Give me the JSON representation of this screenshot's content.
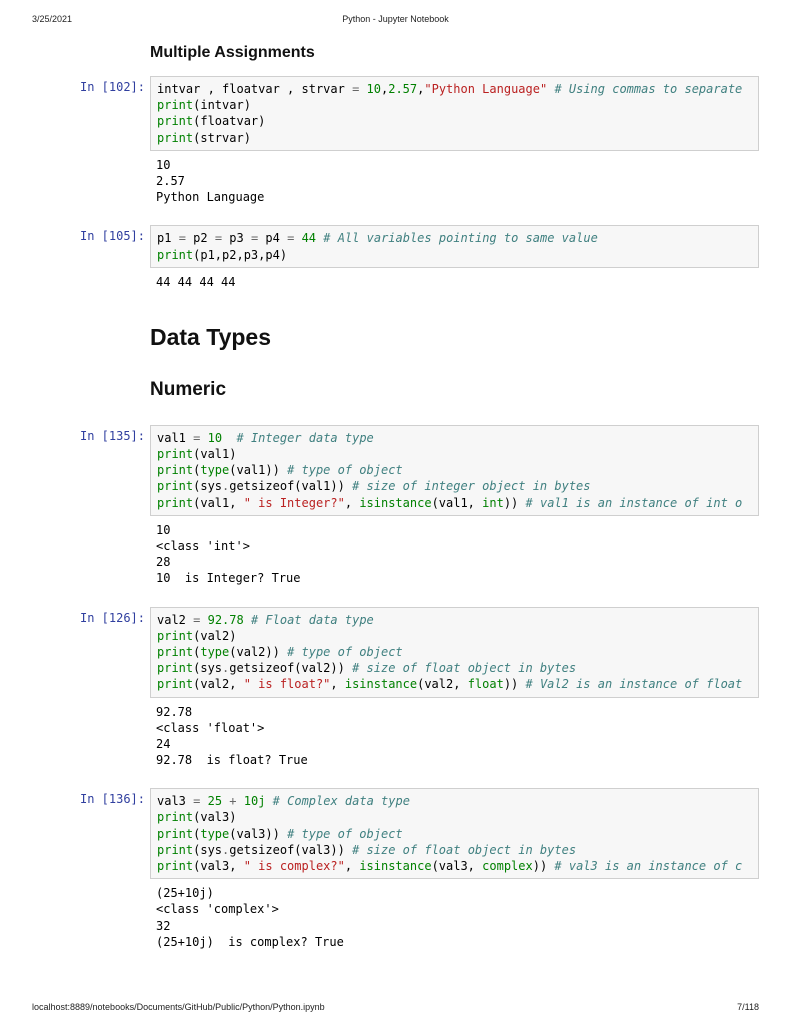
{
  "header": {
    "date": "3/25/2021",
    "title": "Python - Jupyter Notebook"
  },
  "footer": {
    "path": "localhost:8889/notebooks/Documents/GitHub/Public/Python/Python.ipynb",
    "page": "7/118"
  },
  "headings": {
    "multiple_assignments": "Multiple Assignments",
    "data_types": "Data Types",
    "numeric": "Numeric"
  },
  "cells": {
    "c102": {
      "prompt": "In [102]:",
      "code": {
        "l1a": "intvar , floatvar , strvar ",
        "l1b": "=",
        "l1c": " ",
        "l1d": "10",
        "l1e": ",",
        "l1f": "2.57",
        "l1g": ",",
        "l1h": "\"Python Language\"",
        "l1i": " ",
        "l1j": "# Using commas to separate",
        "l2a": "print",
        "l2b": "(intvar)",
        "l3a": "print",
        "l3b": "(floatvar)",
        "l4a": "print",
        "l4b": "(strvar)"
      },
      "output": "10\n2.57\nPython Language"
    },
    "c105": {
      "prompt": "In [105]:",
      "code": {
        "l1a": "p1 ",
        "l1b": "=",
        "l1c": " p2 ",
        "l1d": "=",
        "l1e": " p3 ",
        "l1f": "=",
        "l1g": " p4 ",
        "l1h": "=",
        "l1i": " ",
        "l1j": "44",
        "l1k": " ",
        "l1l": "# All variables pointing to same value",
        "l2a": "print",
        "l2b": "(p1,p2,p3,p4)"
      },
      "output": "44 44 44 44"
    },
    "c135": {
      "prompt": "In [135]:",
      "code": {
        "l1a": "val1 ",
        "l1b": "=",
        "l1c": " ",
        "l1d": "10",
        "l1e": "  ",
        "l1f": "# Integer data type",
        "l2a": "print",
        "l2b": "(val1)",
        "l3a": "print",
        "l3b": "(",
        "l3c": "type",
        "l3d": "(val1)) ",
        "l3e": "# type of object",
        "l4a": "print",
        "l4b": "(sys",
        "l4c": ".",
        "l4d": "getsizeof(val1)) ",
        "l4e": "# size of integer object in bytes",
        "l5a": "print",
        "l5b": "(val1, ",
        "l5c": "\" is Integer?\"",
        "l5d": ", ",
        "l5e": "isinstance",
        "l5f": "(val1, ",
        "l5g": "int",
        "l5h": ")) ",
        "l5i": "# val1 is an instance of int o"
      },
      "output": "10\n<class 'int'>\n28\n10  is Integer? True"
    },
    "c126": {
      "prompt": "In [126]:",
      "code": {
        "l1a": "val2 ",
        "l1b": "=",
        "l1c": " ",
        "l1d": "92.78",
        "l1e": " ",
        "l1f": "# Float data type",
        "l2a": "print",
        "l2b": "(val2)",
        "l3a": "print",
        "l3b": "(",
        "l3c": "type",
        "l3d": "(val2)) ",
        "l3e": "# type of object",
        "l4a": "print",
        "l4b": "(sys",
        "l4c": ".",
        "l4d": "getsizeof(val2)) ",
        "l4e": "# size of float object in bytes",
        "l5a": "print",
        "l5b": "(val2, ",
        "l5c": "\" is float?\"",
        "l5d": ", ",
        "l5e": "isinstance",
        "l5f": "(val2, ",
        "l5g": "float",
        "l5h": ")) ",
        "l5i": "# Val2 is an instance of float"
      },
      "output": "92.78\n<class 'float'>\n24\n92.78  is float? True"
    },
    "c136": {
      "prompt": "In [136]:",
      "code": {
        "l1a": "val3 ",
        "l1b": "=",
        "l1c": " ",
        "l1d": "25",
        "l1e": " ",
        "l1f": "+",
        "l1g": " ",
        "l1h": "10j",
        "l1i": " ",
        "l1j": "# Complex data type",
        "l2a": "print",
        "l2b": "(val3)",
        "l3a": "print",
        "l3b": "(",
        "l3c": "type",
        "l3d": "(val3)) ",
        "l3e": "# type of object",
        "l4a": "print",
        "l4b": "(sys",
        "l4c": ".",
        "l4d": "getsizeof(val3)) ",
        "l4e": "# size of float object in bytes",
        "l5a": "print",
        "l5b": "(val3, ",
        "l5c": "\" is complex?\"",
        "l5d": ", ",
        "l5e": "isinstance",
        "l5f": "(val3, ",
        "l5g": "complex",
        "l5h": ")) ",
        "l5i": "# val3 is an instance of c"
      },
      "output": "(25+10j)\n<class 'complex'>\n32\n(25+10j)  is complex? True"
    }
  }
}
